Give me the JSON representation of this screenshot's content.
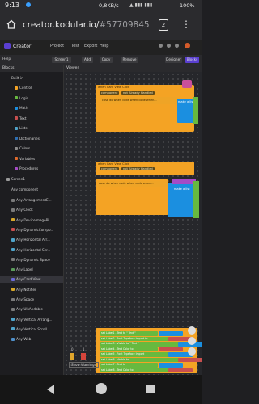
{
  "status": {
    "time": "9:13",
    "net": "0,8KB/s",
    "battery": "100%"
  },
  "browser": {
    "url_domain": "creator.kodular.io/",
    "url_hash": "#57709845",
    "tab_count": "2"
  },
  "app": {
    "title": "Creator",
    "menu": [
      "Project",
      "Test",
      "Export",
      "Help"
    ],
    "help_label": "Help",
    "toolbar": {
      "screen": "Screen1",
      "add": "Add",
      "copy": "Copy",
      "remove": "Remove",
      "designer": "Designer",
      "blocks": "Blocks"
    }
  },
  "panel": {
    "header": "Blocks",
    "viewer": "Viewer",
    "builtin": "Built-in",
    "builtin_items": [
      {
        "label": "Control",
        "color": "#f4a324"
      },
      {
        "label": "Logic",
        "color": "#67b93f"
      },
      {
        "label": "Math",
        "color": "#1b8fe0"
      },
      {
        "label": "Text",
        "color": "#c94f4f"
      },
      {
        "label": "Lists",
        "color": "#4fa3c9"
      },
      {
        "label": "Dictionaries",
        "color": "#2d6fb3"
      },
      {
        "label": "Colors",
        "color": "#8a8a8a"
      },
      {
        "label": "Variables",
        "color": "#e06a2b"
      },
      {
        "label": "Procedures",
        "color": "#a64bc6"
      }
    ],
    "screen": "Screen1",
    "any_component": "Any component",
    "any_items": [
      "Any ArrangementE...",
      "Any Clock",
      "Any DeviceImagePi...",
      "Any DynamicCompo...",
      "Any Horizontal Arr...",
      "Any Horizontal Scr...",
      "Any Dynamic Space",
      "Any Label",
      "Any Card View",
      "Any Notifier",
      "Any Space",
      "Any UIsAndable",
      "Any Vertical Arrang...",
      "Any Vertical Scroll ...",
      "Any Web"
    ],
    "selected": "Any Card View"
  },
  "workspace": {
    "event1": "when Card View Click",
    "component": "component",
    "not_handled": "not Already Handled",
    "stmt1": "case do when code when code when...",
    "event2": "when Card View Click",
    "stmt2": "case do when code when code when...",
    "make_a_list": "make a list",
    "show_warnings": "Show Warnings",
    "counts": [
      "0",
      "1",
      "0"
    ],
    "bottom_rows": [
      "set Label1 . Text to \" Text \"",
      "set Label2 . Font Typeface Import to",
      "set Label3 . Visible to \" Text \"",
      "set Label4 . Text Color to",
      "set Label5 . Font Typeface Import",
      "set Label6 . Visible to",
      "set Label7 . Text to",
      "set Label8 . Text Color to"
    ]
  }
}
